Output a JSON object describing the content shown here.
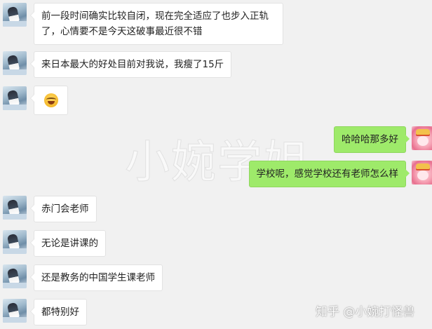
{
  "colors": {
    "background": "#f1f1f1",
    "incoming_bubble": "#ffffff",
    "outgoing_bubble": "#9eea6a"
  },
  "watermark": {
    "text": "小婉学姐"
  },
  "footer_mark": {
    "text": "知乎 @小婉打怪兽"
  },
  "messages": [
    {
      "side": "left",
      "text": "前一段时间确实比较自闭，现在完全适应了也步入正轨了，心情要不是今天这破事最近很不错"
    },
    {
      "side": "left",
      "text": "来日本最大的好处目前对我说，我瘦了15斤"
    },
    {
      "side": "left",
      "icon": "laughing-emoji-icon"
    },
    {
      "side": "right",
      "text": "哈哈哈那多好"
    },
    {
      "side": "right",
      "text": "学校呢，感觉学校还有老师怎么样"
    },
    {
      "side": "left",
      "text": "赤门会老师"
    },
    {
      "side": "left",
      "text": "无论是讲课的"
    },
    {
      "side": "left",
      "text": "还是教务的中国学生课老师"
    },
    {
      "side": "left",
      "text": "都特别好"
    }
  ]
}
